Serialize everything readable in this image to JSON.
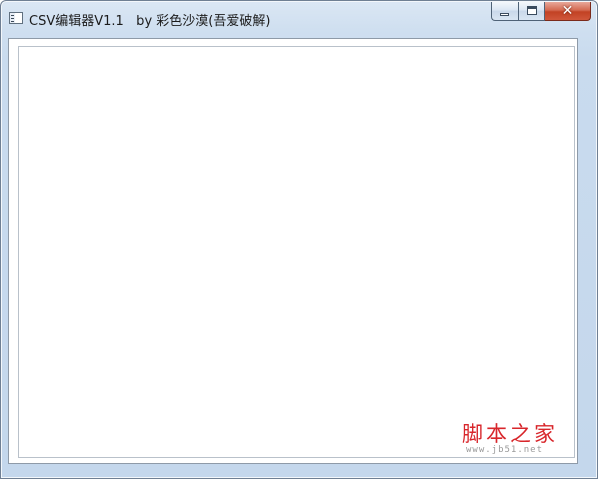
{
  "window": {
    "title": "CSV编辑器V1.1   by 彩色沙漠(吾爱破解)",
    "icon": "app-window-icon",
    "controls": {
      "minimize_icon": "minimize-icon",
      "maximize_icon": "maximize-icon",
      "close_label": "✕"
    }
  },
  "watermark": {
    "main": "脚本之家",
    "sub": "www.jb51.net",
    "color": "#d8262b"
  },
  "colors": {
    "title_bar": "#cfdff0",
    "close_button": "#c24224"
  }
}
